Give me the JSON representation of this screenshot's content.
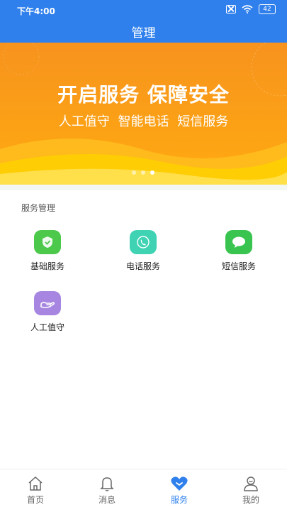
{
  "status": {
    "time": "下午4:00",
    "battery": "42"
  },
  "header": {
    "title": "管理"
  },
  "banner": {
    "title": "开启服务 保障安全",
    "subtitle": "人工值守  智能电话  短信服务",
    "active_dot": 3,
    "colors": {
      "top": "#f7931e",
      "bottom": "#ffb200"
    }
  },
  "section": {
    "title": "服务管理"
  },
  "services": [
    {
      "label": "基础服务",
      "icon": "shield-icon",
      "color": "#4cc84a"
    },
    {
      "label": "电话服务",
      "icon": "phone-icon",
      "color": "#3fd3b4"
    },
    {
      "label": "短信服务",
      "icon": "chat-bubble-icon",
      "color": "#38c44e"
    },
    {
      "label": "人工值守",
      "icon": "hand-icon",
      "color": "#a686e0"
    }
  ],
  "tabs": [
    {
      "label": "首页",
      "icon": "home-icon"
    },
    {
      "label": "消息",
      "icon": "bell-icon"
    },
    {
      "label": "服务",
      "icon": "heart-icon",
      "active": true
    },
    {
      "label": "我的",
      "icon": "user-icon"
    }
  ],
  "accent": "#2f80ec"
}
